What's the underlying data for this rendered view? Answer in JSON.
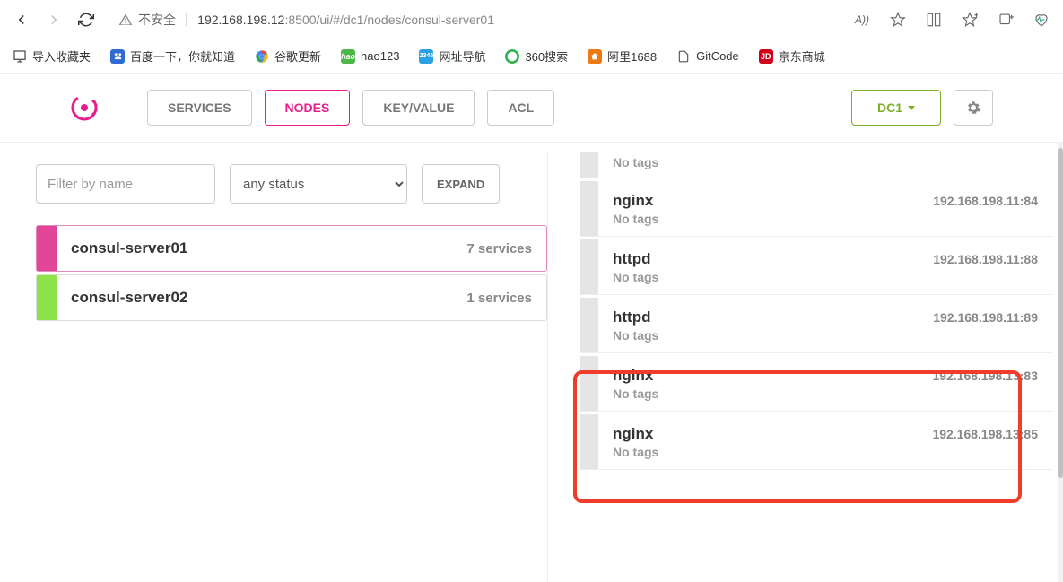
{
  "browser": {
    "insecure_label": "不安全",
    "url_host": "192.168.198.12",
    "url_port": ":8500",
    "url_path": "/ui/#/dc1/nodes/consul-server01",
    "import_label": "导入收藏夹",
    "bookmarks": [
      {
        "label": "百度一下，你就知道",
        "icon_bg": "#2f6cd1",
        "icon_text": ""
      },
      {
        "label": "谷歌更新",
        "icon_bg": "",
        "icon_text": ""
      },
      {
        "label": "hao123",
        "icon_bg": "#4bb749",
        "icon_text": ""
      },
      {
        "label": "网址导航",
        "icon_bg": "#2aa1e0",
        "icon_text": "2345"
      },
      {
        "label": "360搜索",
        "icon_bg": "#2fb351",
        "icon_text": ""
      },
      {
        "label": "阿里1688",
        "icon_bg": "#ef7815",
        "icon_text": ""
      },
      {
        "label": "GitCode",
        "icon_bg": "",
        "icon_text": ""
      },
      {
        "label": "京东商城",
        "icon_bg": "#d0021b",
        "icon_text": "JD"
      }
    ],
    "icons": {
      "read_aloud": "A))",
      "star": "☆",
      "split": "▯▯",
      "favorites": "⭐",
      "collections": "▢+",
      "perf": "❤"
    }
  },
  "header": {
    "tabs": {
      "services": "SERVICES",
      "nodes": "NODES",
      "kv": "KEY/VALUE",
      "acl": "ACL"
    },
    "dc": "DC1"
  },
  "filters": {
    "name_placeholder": "Filter by name",
    "status_value": "any status",
    "expand": "EXPAND"
  },
  "nodes": [
    {
      "name": "consul-server01",
      "count": "7 services",
      "status": "pink",
      "active": true
    },
    {
      "name": "consul-server02",
      "count": "1 services",
      "status": "green",
      "active": false
    }
  ],
  "services": [
    {
      "name": "",
      "addr": "",
      "tags": "No tags",
      "first": true
    },
    {
      "name": "nginx",
      "addr": "192.168.198.11:84",
      "tags": "No tags"
    },
    {
      "name": "httpd",
      "addr": "192.168.198.11:88",
      "tags": "No tags"
    },
    {
      "name": "httpd",
      "addr": "192.168.198.11:89",
      "tags": "No tags"
    },
    {
      "name": "nginx",
      "addr": "192.168.198.13:83",
      "tags": "No tags"
    },
    {
      "name": "nginx",
      "addr": "192.168.198.13:85",
      "tags": "No tags"
    }
  ]
}
